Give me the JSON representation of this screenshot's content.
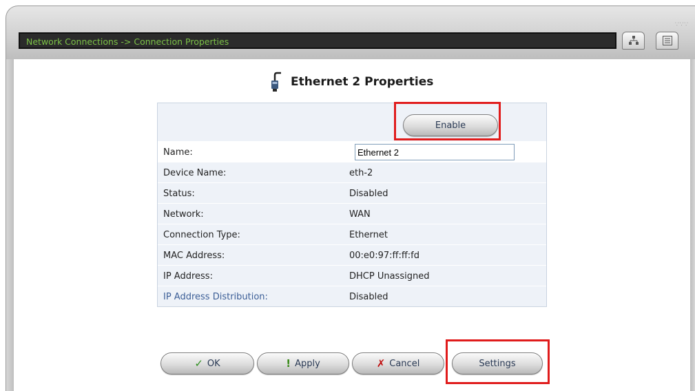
{
  "window": {
    "title": "Network Connections -> Connection Properties",
    "grip_glyph": "∵∵∵",
    "buttons": [
      {
        "name": "network-map-icon"
      },
      {
        "name": "list-view-icon"
      }
    ]
  },
  "page": {
    "heading": "Ethernet 2 Properties",
    "heading_icon": "ethernet-cable-icon"
  },
  "properties": {
    "enable_button": "Enable",
    "name_label": "Name:",
    "name_value": "Ethernet 2",
    "rows": [
      {
        "label": "Device Name:",
        "value": "eth-2"
      },
      {
        "label": "Status:",
        "value": "Disabled"
      },
      {
        "label": "Network:",
        "value": "WAN"
      },
      {
        "label": "Connection Type:",
        "value": "Ethernet"
      },
      {
        "label": "MAC Address:",
        "value": "00:e0:97:ff:ff:fd"
      },
      {
        "label": "IP Address:",
        "value": "DHCP Unassigned"
      },
      {
        "label": "IP Address Distribution:",
        "value": "Disabled"
      }
    ]
  },
  "actions": {
    "ok": {
      "label": "OK",
      "glyph": "✓",
      "glyph_color": "#2f8f1f"
    },
    "apply": {
      "label": "Apply",
      "glyph": "!",
      "glyph_color": "#3a8a1a"
    },
    "cancel": {
      "label": "Cancel",
      "glyph": "✗",
      "glyph_color": "#c01010"
    },
    "settings": {
      "label": "Settings"
    }
  },
  "colors": {
    "title_text": "#7cc247",
    "highlight": "#e01b1b",
    "link_label": "#3a5d96"
  }
}
